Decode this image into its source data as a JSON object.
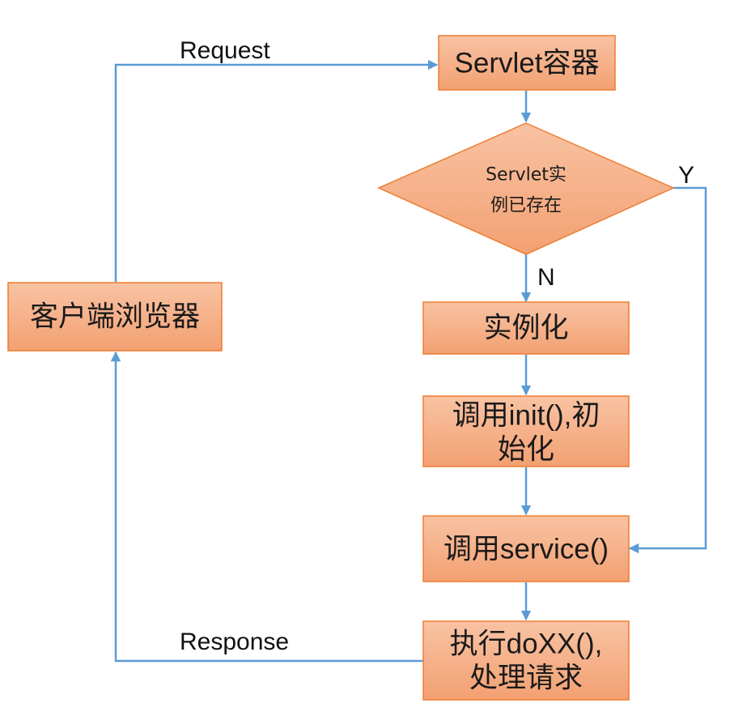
{
  "nodes": {
    "servlet_container": {
      "label": "Servlet容器"
    },
    "decision": {
      "lines": [
        "Servlet实",
        "例已存在"
      ]
    },
    "instantiate": {
      "label": "实例化"
    },
    "init": {
      "lines": [
        "调用init(),初",
        "始化"
      ]
    },
    "service": {
      "label": "调用service()"
    },
    "doxx": {
      "lines": [
        "执行doXX(),",
        "处理请求"
      ]
    },
    "browser": {
      "label": "客户端浏览器"
    }
  },
  "edges": {
    "request_label": "Request",
    "response_label": "Response",
    "yes_label": "Y",
    "no_label": "N"
  },
  "colors": {
    "box_fill_top": "#f8c3a3",
    "box_fill_bottom": "#f3a072",
    "box_stroke": "#ed7d31",
    "arrow": "#5b9bd5"
  }
}
